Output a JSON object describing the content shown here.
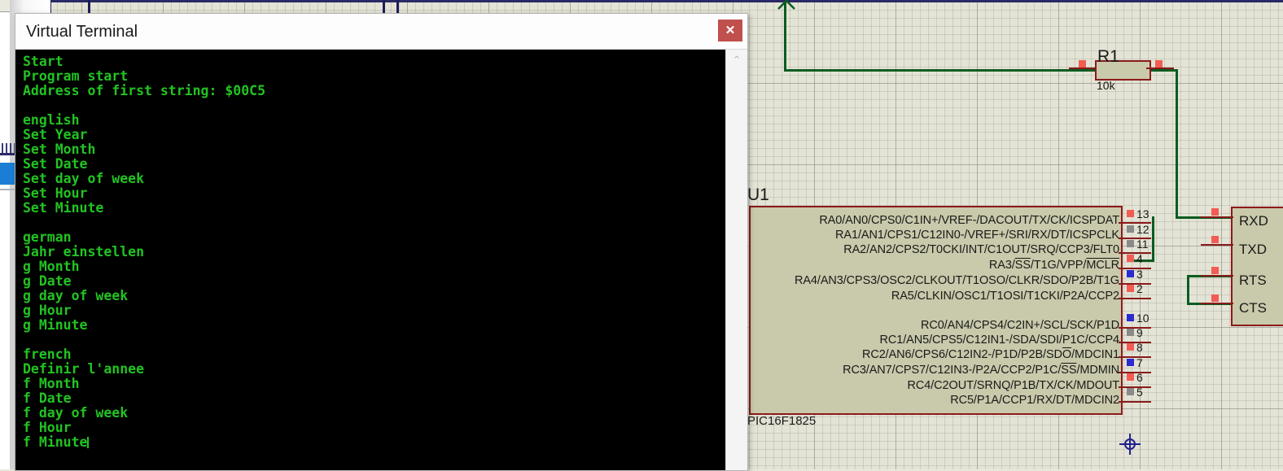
{
  "window": {
    "title": "Virtual Terminal",
    "close_label": "✕"
  },
  "terminal": {
    "lines": [
      "Start",
      "Program start",
      "Address of first string: $00C5",
      "",
      "english",
      "Set Year",
      "Set Month",
      "Set Date",
      "Set day of week",
      "Set Hour",
      "Set Minute",
      "",
      "german",
      "Jahr einstellen",
      "g Month",
      "g Date",
      "g day of week",
      "g Hour",
      "g Minute",
      "",
      "french",
      "Definir l'annee",
      "f Month",
      "f Date",
      "f day of week",
      "f Hour",
      "f Minute"
    ],
    "text_color": "#22c322",
    "background_color": "#000000",
    "scroll_up_icon": "⌃"
  },
  "schematic": {
    "u1": {
      "reference": "U1",
      "value": "PIC16F1825",
      "port_a_pins": [
        {
          "num": "13",
          "name": "RA0/AN0/CPS0/C1IN+/VREF-/DACOUT/TX/CK/ICSPDAT"
        },
        {
          "num": "12",
          "name": "RA1/AN1/CPS1/C12IN0-/VREF+/SRI/RX/DT/ICSPCLK"
        },
        {
          "num": "11",
          "name": "RA2/AN2/CPS2/T0CKI/INT/C1OUT/SRQ/CCP3/FLT0"
        },
        {
          "num": "4",
          "name": "RA3/SS/T1G/VPP/MCLR"
        },
        {
          "num": "3",
          "name": "RA4/AN3/CPS3/OSC2/CLKOUT/T1OSO/CLKR/SDO/P2B/T1G"
        },
        {
          "num": "2",
          "name": "RA5/CLKIN/OSC1/T1OSI/T1CKI/P2A/CCP2"
        }
      ],
      "port_c_pins": [
        {
          "num": "10",
          "name": "RC0/AN4/CPS4/C2IN+/SCL/SCK/P1D"
        },
        {
          "num": "9",
          "name": "RC1/AN5/CPS5/C12IN1-/SDA/SDI/P1C/CCP4"
        },
        {
          "num": "8",
          "name": "RC2/AN6/CPS6/C12IN2-/P1D/P2B/SDO/MDCIN1"
        },
        {
          "num": "7",
          "name": "RC3/AN7/CPS7/C12IN3-/P2A/CCP2/P1C/SS/MDMIN"
        },
        {
          "num": "6",
          "name": "RC4/C2OUT/SRNQ/P1B/TX/CK/MDOUT"
        },
        {
          "num": "5",
          "name": "RC5/P1A/CCP1/RX/DT/MDCIN2"
        }
      ]
    },
    "r1": {
      "reference": "R1",
      "value": "10k"
    },
    "terminals": [
      "RXD",
      "TXD",
      "RTS",
      "CTS"
    ],
    "colors": {
      "wire": "#0a5c20",
      "component_outline": "#8b1a1a",
      "component_fill": "#c9c9ab",
      "grid": "#e4e4d6"
    }
  }
}
